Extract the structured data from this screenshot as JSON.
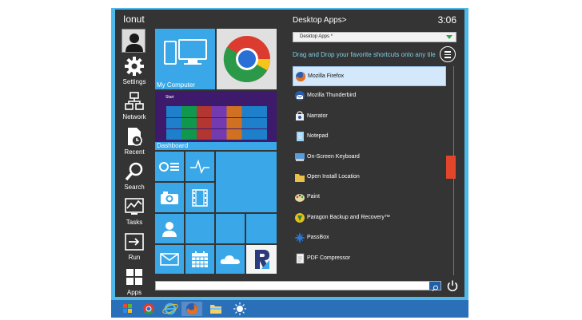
{
  "user": {
    "name": "Ionut"
  },
  "rail": [
    {
      "label": "Settings",
      "icon": "gear-icon"
    },
    {
      "label": "Network",
      "icon": "network-icon"
    },
    {
      "label": "Recent",
      "icon": "recent-icon"
    },
    {
      "label": "Search",
      "icon": "search-icon"
    },
    {
      "label": "Tasks",
      "icon": "tasks-icon"
    },
    {
      "label": "Run",
      "icon": "run-icon"
    },
    {
      "label": "Apps",
      "icon": "apps-icon"
    }
  ],
  "tiles": {
    "my_computer": "My Computer",
    "dashboard": "Dashboard",
    "dashboard_start": "Start"
  },
  "header": {
    "title": "Desktop Apps>",
    "time": "3:06"
  },
  "dropdown": {
    "value": "Desktop Apps *"
  },
  "hint": "Drag and Drop your favorite shortcuts onto any tile",
  "apps": [
    {
      "name": "Mozilla Firefox",
      "selected": true,
      "icon": "firefox-icon"
    },
    {
      "name": "Mozilla Thunderbird",
      "selected": false,
      "icon": "thunderbird-icon"
    },
    {
      "name": "Narrator",
      "selected": false,
      "icon": "narrator-icon"
    },
    {
      "name": "Notepad",
      "selected": false,
      "icon": "notepad-icon"
    },
    {
      "name": "On-Screen Keyboard",
      "selected": false,
      "icon": "keyboard-icon"
    },
    {
      "name": "Open Install Location",
      "selected": false,
      "icon": "folder-icon"
    },
    {
      "name": "Paint",
      "selected": false,
      "icon": "paint-icon"
    },
    {
      "name": "Paragon Backup and Recovery™",
      "selected": false,
      "icon": "paragon-icon"
    },
    {
      "name": "PassBox",
      "selected": false,
      "icon": "passbox-icon"
    },
    {
      "name": "PDF Compressor",
      "selected": false,
      "icon": "pdf-icon"
    }
  ],
  "colors": {
    "tile": "#3aa8e8",
    "menu_bg": "#343434",
    "scroll_thumb": "#e2462a",
    "taskbar": "#2a70b8"
  }
}
